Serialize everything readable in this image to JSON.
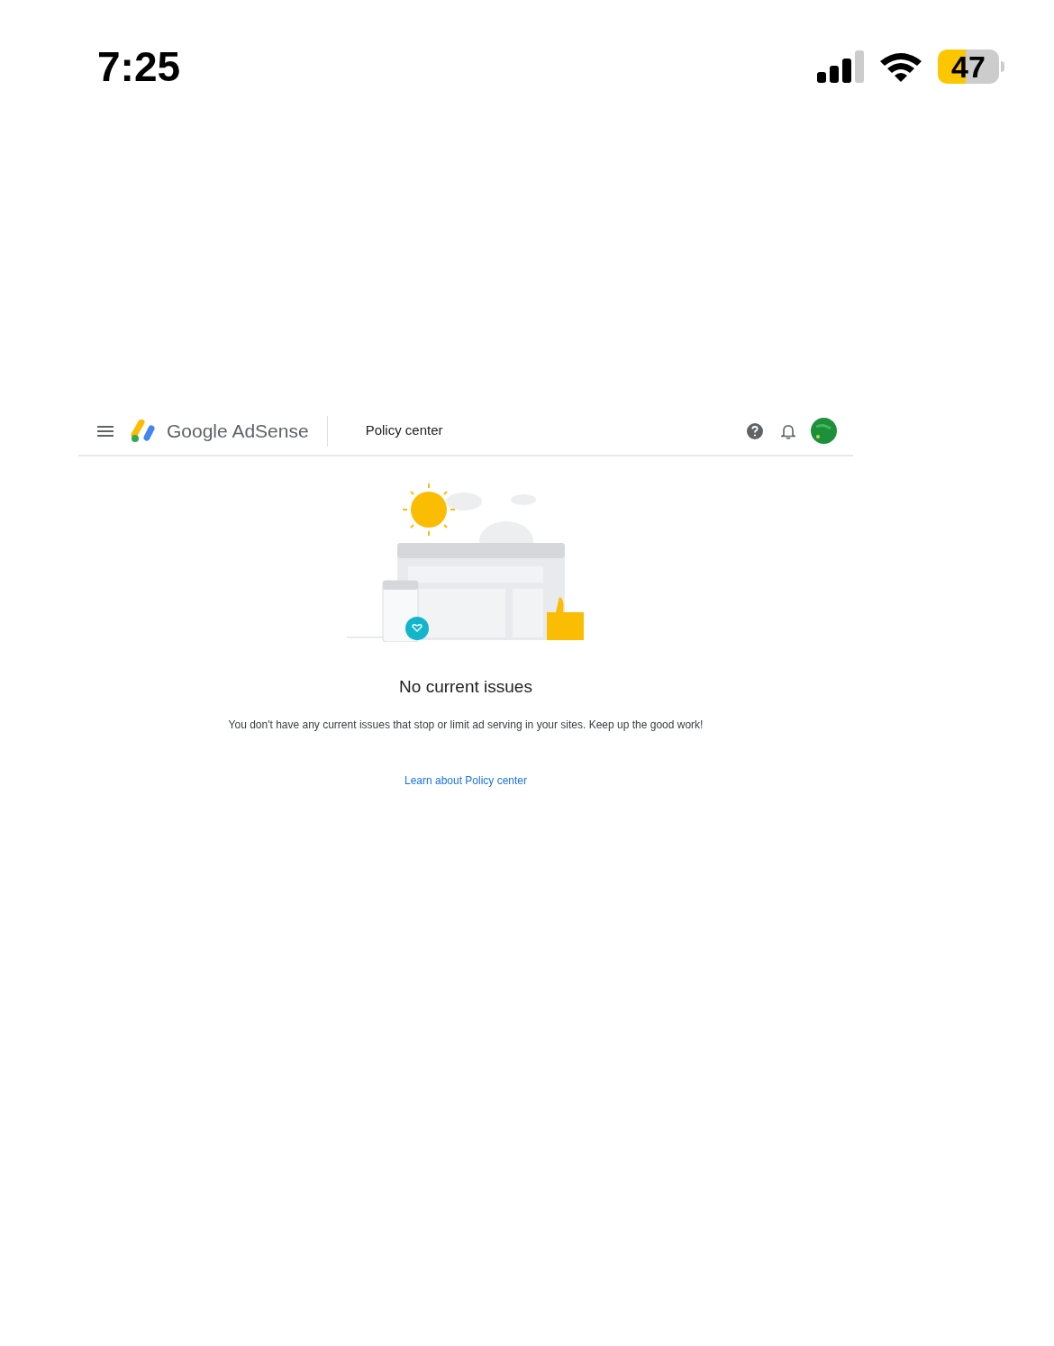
{
  "status_bar": {
    "time": "7:25",
    "battery": "47"
  },
  "header": {
    "brand": "Google AdSense",
    "page_title": "Policy center"
  },
  "empty_state": {
    "title": "No current issues",
    "message": "You don't have any current issues that stop or limit ad serving in your sites. Keep up the good work!",
    "link": "Learn about Policy center"
  }
}
